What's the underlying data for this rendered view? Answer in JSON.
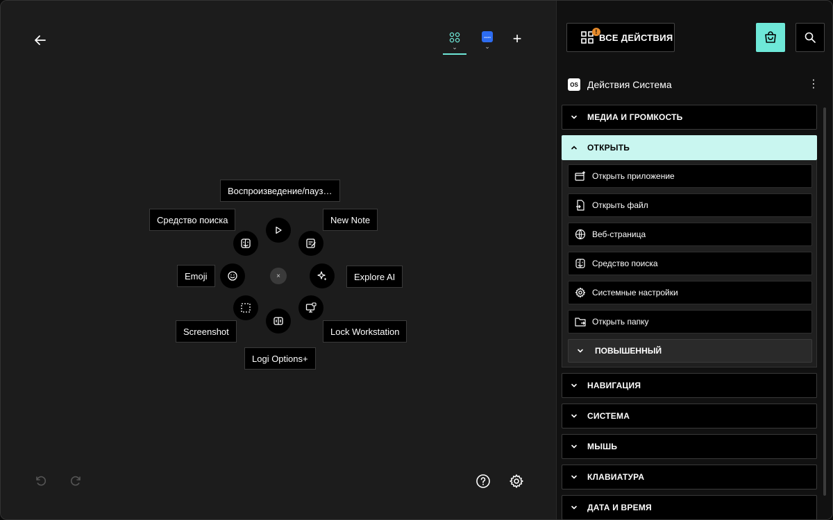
{
  "window": {
    "traffic_lights": [
      "close",
      "minimize",
      "zoom-disabled"
    ]
  },
  "toolbar": {
    "back_icon": "arrow-left-icon",
    "devices": [
      {
        "name": "app-grid",
        "icon": "four-circles-icon",
        "active": true
      },
      {
        "name": "zoom-app",
        "icon": "zoom-app-icon",
        "icon_text": "zoom",
        "active": false
      }
    ],
    "add_label": "+"
  },
  "radial": {
    "center_label": "×",
    "items": [
      {
        "key": "play",
        "label": "Воспроизведение/пауз…",
        "icon": "play-icon"
      },
      {
        "key": "note",
        "label": "New Note",
        "icon": "note-edit-icon"
      },
      {
        "key": "ai",
        "label": "Explore AI",
        "icon": "sparkles-icon"
      },
      {
        "key": "lock",
        "label": "Lock Workstation",
        "icon": "monitor-lock-icon"
      },
      {
        "key": "logi",
        "label": "Logi Options+",
        "icon": "logi-options-icon"
      },
      {
        "key": "screenshot",
        "label": "Screenshot",
        "icon": "screenshot-select-icon"
      },
      {
        "key": "emoji",
        "label": "Emoji",
        "icon": "smiley-icon"
      },
      {
        "key": "finder",
        "label": "Средство поиска",
        "icon": "finder-icon"
      }
    ]
  },
  "bottom": {
    "undo_icon": "undo-icon",
    "redo_icon": "redo-icon",
    "help_icon": "help-circle-icon",
    "settings_icon": "gear-icon"
  },
  "panel": {
    "all_actions_label": "ВСЕ ДЕЙСТВИЯ",
    "all_actions_badge": "!",
    "section_badge": "OS",
    "section_title": "Действия Система",
    "categories_before": [
      {
        "label": "МЕДИА И ГРОМКОСТЬ"
      }
    ],
    "open_category": {
      "label": "ОТКРЫТЬ",
      "items": [
        {
          "label": "Открыть приложение",
          "icon": "app-window-plus-icon"
        },
        {
          "label": "Открыть файл",
          "icon": "file-open-icon"
        },
        {
          "label": "Веб-страница",
          "icon": "globe-icon"
        },
        {
          "label": "Средство поиска",
          "icon": "finder-icon"
        },
        {
          "label": "Системные настройки",
          "icon": "gear-icon"
        },
        {
          "label": "Открыть папку",
          "icon": "folder-open-icon"
        }
      ],
      "advanced_label": "ПОВЫШЕННЫЙ"
    },
    "categories_after": [
      {
        "label": "НАВИГАЦИЯ"
      },
      {
        "label": "СИСТЕМА"
      },
      {
        "label": "МЫШЬ"
      },
      {
        "label": "КЛАВИАТУРА"
      },
      {
        "label": "ДАТА И ВРЕМЯ"
      }
    ]
  },
  "colors": {
    "accent": "#6ee8d8",
    "open_header": "#c9f6f0",
    "badge": "#e58a2b"
  }
}
